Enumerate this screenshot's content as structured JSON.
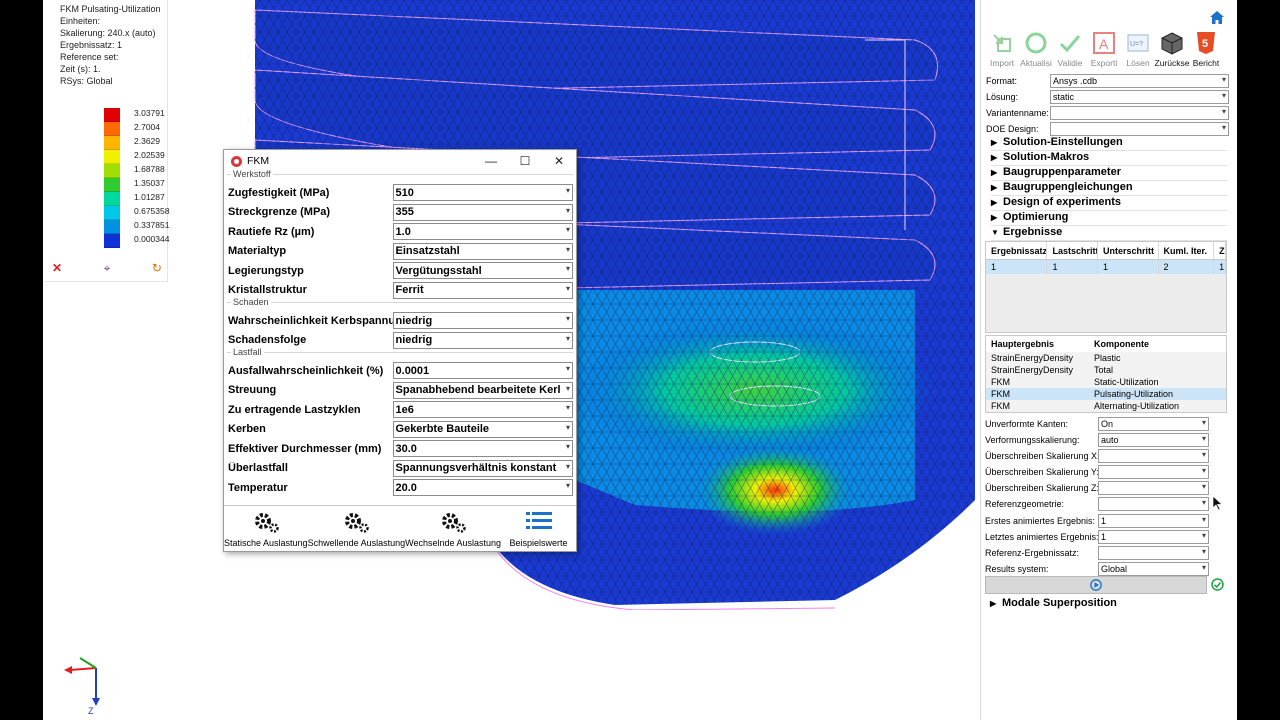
{
  "legend": {
    "title": "FKM Pulsating-Utilization",
    "units": "Einheiten:",
    "scaling": "Skalierung: 240.x (auto)",
    "result_set": "Ergebnissatz: 1",
    "reference_set": "Reference set:",
    "time": "Zeit (s): 1.",
    "rsys": "RSys: Global",
    "values": [
      "3.03791",
      "2.7004",
      "2.3629",
      "2.02539",
      "1.68788",
      "1.35037",
      "1.01287",
      "0.675358",
      "0.337851",
      "0.000344"
    ],
    "colors": [
      "#e00000",
      "#ff6a00",
      "#ffb400",
      "#f0f000",
      "#a0e000",
      "#2ecc2e",
      "#00d8a0",
      "#00c8e8",
      "#0090e0",
      "#1030d8"
    ]
  },
  "fkm": {
    "title": "FKM",
    "groups": [
      {
        "title": "Werkstoff",
        "rows": [
          {
            "label": "Zugfestigkeit (MPa)",
            "value": "510"
          },
          {
            "label": "Streckgrenze (MPa)",
            "value": "355"
          },
          {
            "label": "Rautiefe Rz (µm)",
            "value": "1.0"
          },
          {
            "label": "Materialtyp",
            "value": "Einsatzstahl"
          },
          {
            "label": "Legierungstyp",
            "value": "Vergütungsstahl"
          },
          {
            "label": "Kristallstruktur",
            "value": "Ferrit"
          }
        ]
      },
      {
        "title": "Schaden",
        "rows": [
          {
            "label": "Wahrscheinlichkeit Kerbspannu",
            "value": "niedrig"
          },
          {
            "label": "Schadensfolge",
            "value": "niedrig"
          }
        ]
      },
      {
        "title": "Lastfall",
        "rows": [
          {
            "label": "Ausfallwahrscheinlichkeit (%)",
            "value": "0.0001"
          },
          {
            "label": "Streuung",
            "value": "Spanabhebend bearbeitete Kerl"
          },
          {
            "label": "Zu ertragende Lastzyklen",
            "value": "1e6"
          },
          {
            "label": "Kerben",
            "value": "Gekerbte Bauteile"
          },
          {
            "label": "Effektiver Durchmesser (mm)",
            "value": "30.0"
          },
          {
            "label": "Überlastfall",
            "value": "Spannungsverhältnis konstant"
          },
          {
            "label": "Temperatur",
            "value": "20.0"
          }
        ]
      }
    ],
    "tools": [
      "Statische Auslastung",
      "Schwellende Auslastung",
      "Wechselnde Auslastung",
      "Beispielswerte"
    ]
  },
  "panel": {
    "toolbar": [
      {
        "label": "Import",
        "active": false
      },
      {
        "label": "Aktualisi",
        "active": false
      },
      {
        "label": "Validie",
        "active": false
      },
      {
        "label": "Exporti",
        "active": false
      },
      {
        "label": "Lösen",
        "active": false
      },
      {
        "label": "Zurückse",
        "active": true
      },
      {
        "label": "Bericht",
        "active": true
      }
    ],
    "props": [
      {
        "label": "Format:",
        "value": "Ansys .cdb"
      },
      {
        "label": "Lösung:",
        "value": "static"
      },
      {
        "label": "Variantenname:",
        "value": ""
      },
      {
        "label": "DOE Design:",
        "value": ""
      }
    ],
    "sections": [
      {
        "label": "Solution-Einstellungen",
        "open": false
      },
      {
        "label": "Solution-Makros",
        "open": false
      },
      {
        "label": "Baugruppenparameter",
        "open": false
      },
      {
        "label": "Baugruppengleichungen",
        "open": false
      },
      {
        "label": "Design of experiments",
        "open": false
      },
      {
        "label": "Optimierung",
        "open": false
      },
      {
        "label": "Ergebnisse",
        "open": true
      }
    ],
    "result_table": {
      "headers": [
        "Ergebnissatz",
        "Lastschritt",
        "Unterschritt",
        "Kuml. Iter.",
        "Ze"
      ],
      "row": [
        "1",
        "1",
        "1",
        "2",
        "1."
      ]
    },
    "main_results": {
      "headers": [
        "Hauptergebnis",
        "Komponente"
      ],
      "rows": [
        [
          "StrainEnergyDensity",
          "Plastic"
        ],
        [
          "StrainEnergyDensity",
          "Total"
        ],
        [
          "FKM",
          "Static-Utilization"
        ],
        [
          "FKM",
          "Pulsating-Utilization"
        ],
        [
          "FKM",
          "Alternating-Utilization"
        ]
      ],
      "selected": 3
    },
    "view_props": [
      {
        "label": "Unverformte Kanten:",
        "value": "On"
      },
      {
        "label": "Verformungsskalierung:",
        "value": "auto"
      },
      {
        "label": "Überschreiben Skalierung X:",
        "value": ""
      },
      {
        "label": "Überschreiben Skalierung Y:",
        "value": ""
      },
      {
        "label": "Überschreiben Skalierung Z:",
        "value": ""
      },
      {
        "label": "Referenzgeometrie:",
        "value": ""
      },
      {
        "label": "Erstes animiertes Ergebnis:",
        "value": "1"
      },
      {
        "label": "Letztes animiertes Ergebnis:",
        "value": "1"
      },
      {
        "label": "Referenz-Ergebnissatz:",
        "value": ""
      },
      {
        "label": "Results system:",
        "value": "Global"
      }
    ],
    "modal_section": "Modale Superposition"
  },
  "triad_label": "Z"
}
